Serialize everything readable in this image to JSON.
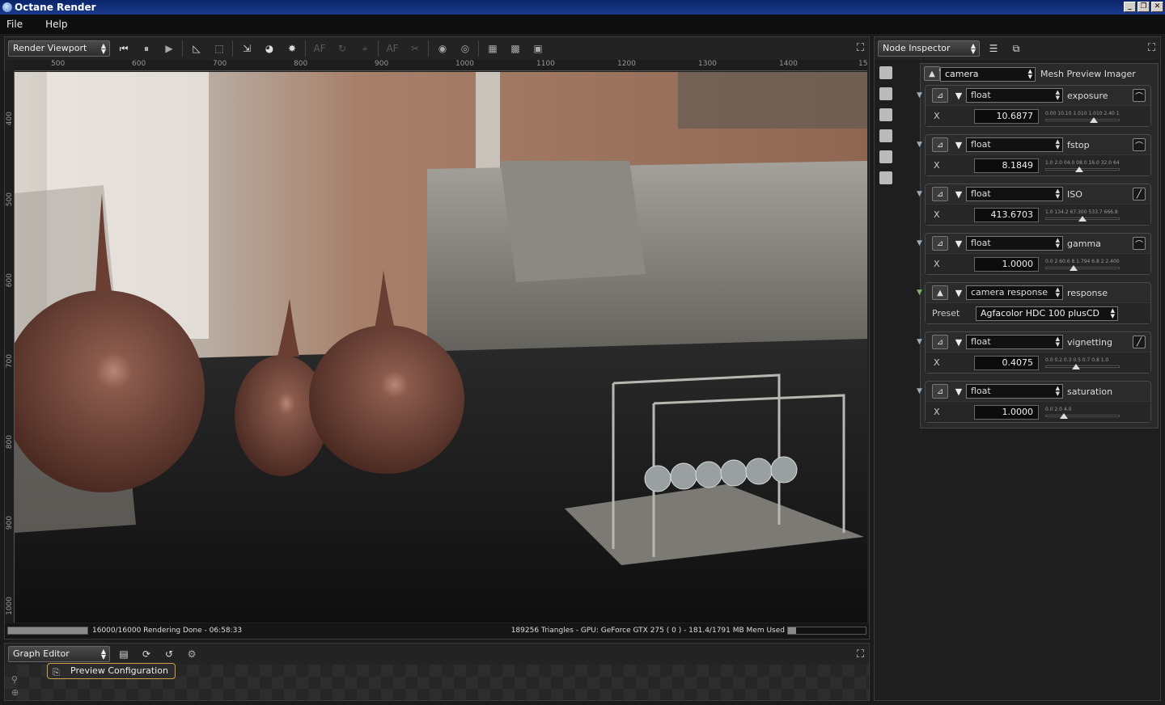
{
  "window": {
    "title": "Octane Render"
  },
  "menu": [
    "File",
    "Help"
  ],
  "viewport": {
    "selector": "Render Viewport",
    "ruler_x": [
      "500",
      "600",
      "700",
      "800",
      "900",
      "1000",
      "1100",
      "1200",
      "1300",
      "1400",
      "15"
    ],
    "ruler_y": [
      "400",
      "500",
      "600",
      "700",
      "800",
      "900",
      "1000"
    ],
    "progress_fraction": 1.0,
    "status_left": "16000/16000 Rendering Done - 06:58:33",
    "status_right": "189256 Triangles - GPU: GeForce GTX 275 ( 0 ) - 181.4/1791 MB Mem Used"
  },
  "graph_editor": {
    "selector": "Graph Editor",
    "node_label": "Preview Configuration"
  },
  "inspector": {
    "selector": "Node Inspector",
    "root": {
      "type": "camera",
      "name": "Mesh Preview Imager"
    },
    "nodes": [
      {
        "type": "float",
        "name": "exposure",
        "axis": "X",
        "value": "10.6877",
        "ticks": "0.00 10.10 1.010 1.010 2.40 1.0",
        "knob": 0.65,
        "curve": "curve-icon"
      },
      {
        "type": "float",
        "name": "fstop",
        "axis": "X",
        "value": "8.1849",
        "ticks": "1.0 2.0 04.0 08.0 16.0 32.0 64.0",
        "knob": 0.46,
        "curve": "curve-icon"
      },
      {
        "type": "float",
        "name": "ISO",
        "axis": "X",
        "value": "413.6703",
        "ticks": "1.0 134.2 67.300 533.7 666.8 0",
        "knob": 0.5,
        "curve": "line-icon"
      },
      {
        "type": "float",
        "name": "gamma",
        "axis": "X",
        "value": "1.0000",
        "ticks": "0.0 2 60.6 8 1.794 6.8 2 2.400",
        "knob": 0.38,
        "curve": "curve-icon"
      },
      {
        "type": "camera response",
        "name": "response",
        "preset_label": "Preset",
        "preset": "Agfacolor HDC 100 plusCD"
      },
      {
        "type": "float",
        "name": "vignetting",
        "axis": "X",
        "value": "0.4075",
        "ticks": "0.0 0.2 0.3 0.5 0.7 0.8 1.0",
        "knob": 0.41,
        "curve": "line-icon"
      },
      {
        "type": "float",
        "name": "saturation",
        "axis": "X",
        "value": "1.0000",
        "ticks": "0.0 2.0 4.0",
        "knob": 0.25,
        "curve": "none"
      }
    ]
  }
}
